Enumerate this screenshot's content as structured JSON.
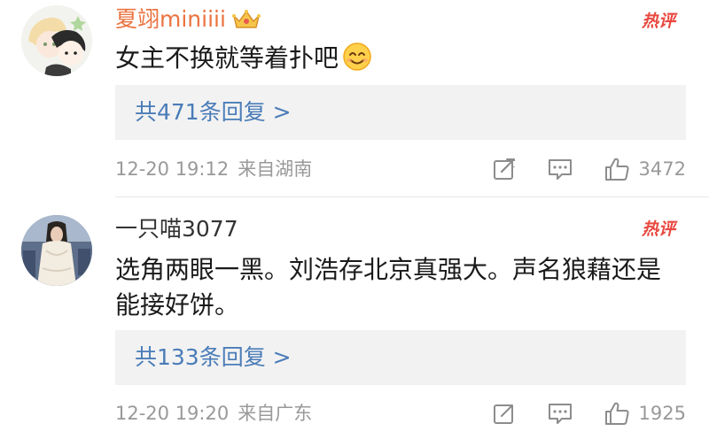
{
  "comments": [
    {
      "username": "夏翊miniiii",
      "text": "女主不换就等着扑吧",
      "replies_label": "共471条回复 >",
      "time": "12-20 19:12",
      "location": "来自湖南",
      "likes": "3472",
      "name_color": "#eb7340",
      "icons": {
        "avatar": "avatar",
        "badge": "crown-icon",
        "hot": "hot-comment-badge",
        "emoji": "smile-emoji"
      }
    },
    {
      "username": "一只喵3077",
      "text": "选角两眼一黑。刘浩存北京真强大。声名狼藉还是能接好饼。",
      "replies_label": "共133条回复 >",
      "time": "12-20 19:20",
      "location": "来自广东",
      "likes": "1925",
      "name_color": "#333333",
      "icons": {
        "avatar": "avatar",
        "hot": "hot-comment-badge"
      }
    }
  ],
  "hot_badge_label": "热评",
  "colors": {
    "link": "#4a7cb8",
    "meta": "#999999",
    "reply_bg": "#f2f2f2",
    "hot_badge": "#e8483f"
  }
}
